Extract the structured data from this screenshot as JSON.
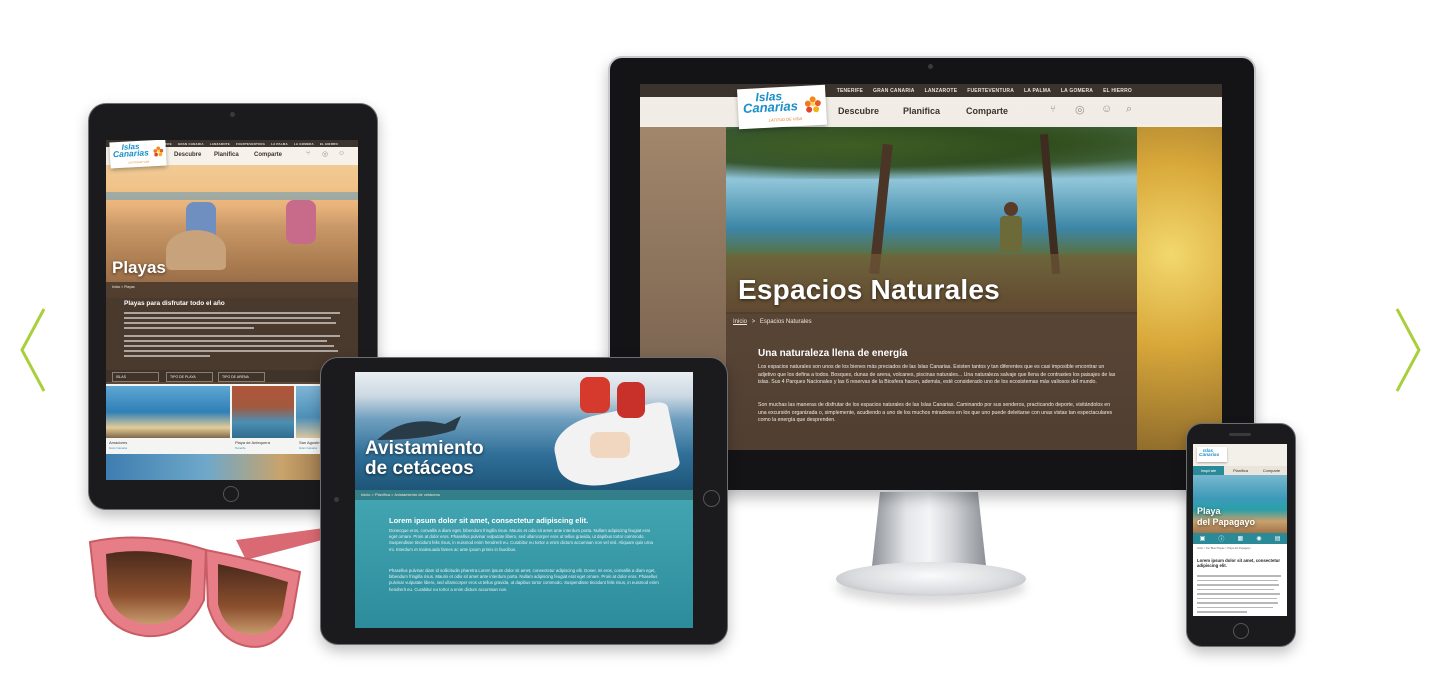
{
  "brand": {
    "name_line1": "Islas",
    "name_line2": "Canarias",
    "tagline": "LATITUD DE VIDA",
    "primary_color": "#1a8fc9",
    "accent_color": "#e07b1a",
    "arrow_color": "#a9cf3a"
  },
  "carousel": {
    "prev_icon": "chevron-left-icon",
    "next_icon": "chevron-right-icon"
  },
  "desktop": {
    "islands": [
      "TENERIFE",
      "GRAN CANARIA",
      "LANZAROTE",
      "FUERTEVENTURA",
      "LA PALMA",
      "LA GOMERA",
      "EL HIERRO"
    ],
    "nav": [
      "Descubre",
      "Planifica",
      "Comparte"
    ],
    "icons": [
      "share-icon",
      "globe-icon",
      "user-icon",
      "search-icon"
    ],
    "hero_title": "Espacios Naturales",
    "breadcrumb_home": "Inicio",
    "breadcrumb_sep": ">",
    "breadcrumb_current": "Espacios Naturales",
    "heading": "Una naturaleza llena de energía",
    "paragraph1": "Los espacios naturales son unos de los bienes más preciados de las Islas Canarias. Existen tantos y tan diferentes que es casi imposible encontrar un adjetivo que los defina a todos. Bosques, dunas de arena, volcanes, piscinas naturales... Una naturaleza salvaje que llena de contrastes los paisajes de las islas. Sus 4 Parques Nacionales y las 6 reservas de la Biosfera hacen, además, esté considerado uno de los ecosistemas más valiosos del mundo.",
    "paragraph2": "Son muchas las maneras de disfrutar de los espacios naturales de las Islas Canarias. Caminando por sus senderos, practicando deporte, visitándolos en una excursión organizada o, simplemente, acudiendo a uno de los muchos miradores en los que uno puede deleitarse con unas vistas tan espectaculares como la energía que desprenden."
  },
  "tablet_left": {
    "nav": [
      "Descubre",
      "Planifica",
      "Comparte"
    ],
    "hero_title": "Playas",
    "breadcrumb": "Inicio > Playas",
    "heading": "Playas para disfrutar todo el año",
    "filters": [
      "ISLAS",
      "TIPO DE PLAYA",
      "TIPO DE ARENA"
    ],
    "cards": [
      {
        "title": "Amadores",
        "island": "Gran Canaria"
      },
      {
        "title": "Playa de Antequera",
        "island": "Tenerife"
      },
      {
        "title": "San Agustín",
        "island": "Gran Canaria"
      }
    ]
  },
  "tablet_center": {
    "hero_title_line1": "Avistamiento",
    "hero_title_line2": "de cetáceos",
    "breadcrumb": "Inicio > Planifica > Avistamiento de cetáceos",
    "heading": "Lorem ipsum dolor sit amet, consectetur adipiscing elit.",
    "paragraph1": "Donecque eros, convallis a diam eget, bibendum fringilla risus. Mauris et odio sit amet ante interdum porta. Nullam adipiscing feugiat erat eget ornare. Proin at dolor eros. Phasellus pulvinar vulputate libero, sed ullamcorper eros ut tellus gravida, ut dapibus tortor commodo. Suspendisse tincidunt felis risus, in euismod enim hendrerit eu. Curabitur eu tortor a enim dictum accumsan non vel nisl. Aliquam quis urna mi. Interdum et malesuada fames ac ante ipsum primis in faucibus.",
    "paragraph2": "Phasellus pulvinar diam id sollicitudin pharetra.Lorem ipsum dolor sit amet, consectetur adipiscing elit. Donec mi eros, convallis a diam eget, bibendum fringilla risus. Mauris et odio sit amet ante interdum porta. Nullam adipiscing feugiat erat eget ornare. Proin at dolor eros. Phasellus pulvinar vulputate libero, sed ullamcorper eros ut tellus gravida, ut dapibus tortor commodo. Suspendisse tincidunt felis risus, in euismod enim hendrerit eu. Curabitur eu tortor a enim dictum accumsan non."
  },
  "phone": {
    "nav": [
      "Inspírate",
      "Planifica",
      "Comparte"
    ],
    "hero_title_line1": "Playa",
    "hero_title_line2": "del Papagayo",
    "breadcrumb": "Inicio > Sur Blue Playas > Playa del Papagayo",
    "heading": "Lorem ipsum dolor sit amet, consectetur adipiscing elit."
  }
}
